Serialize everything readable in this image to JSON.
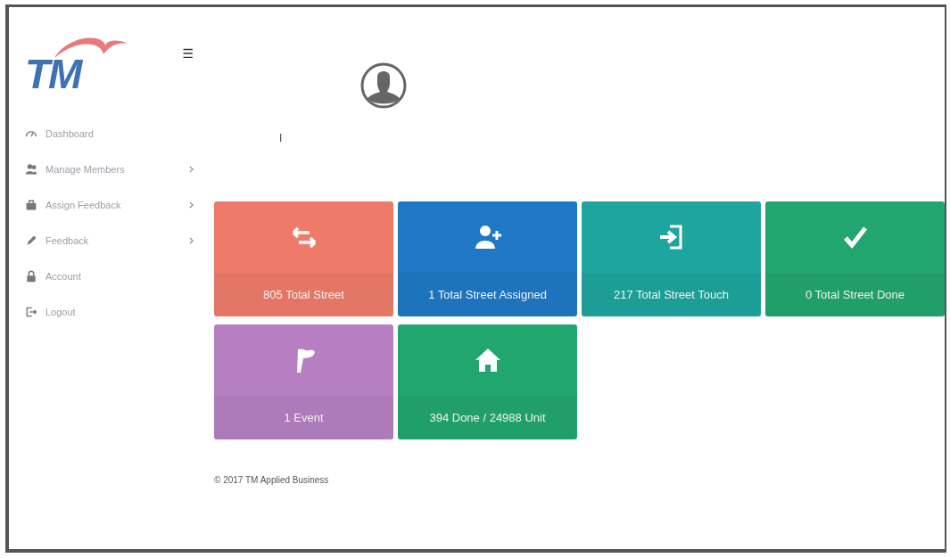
{
  "logo": {
    "text": "TM"
  },
  "menu_button": {
    "icon": "☰"
  },
  "sidebar": {
    "items": [
      {
        "label": "Dashboard",
        "kind": "gauge",
        "has_submenu": false
      },
      {
        "label": "Manage Members",
        "kind": "users",
        "has_submenu": true
      },
      {
        "label": "Assign Feedback",
        "kind": "briefcase",
        "has_submenu": true
      },
      {
        "label": "Feedback",
        "kind": "pen",
        "has_submenu": true
      },
      {
        "label": "Account",
        "kind": "lock",
        "has_submenu": false
      },
      {
        "label": "Logout",
        "kind": "logout",
        "has_submenu": false
      }
    ]
  },
  "profile": {
    "name": "I"
  },
  "tiles": [
    {
      "label": "805 Total Street",
      "kind": "exchange",
      "color": "#ee7b6a"
    },
    {
      "label": "1 Total Street Assigned",
      "kind": "userplus",
      "color": "#1f78c4"
    },
    {
      "label": "217 Total Street Touch",
      "kind": "signin",
      "color": "#1ea59d"
    },
    {
      "label": "0 Total Street Done",
      "kind": "check",
      "color": "#22a66f"
    },
    {
      "label": "1 Event",
      "kind": "flag",
      "color": "#b57fc2"
    },
    {
      "label": "394 Done / 24988 Unit",
      "kind": "home",
      "color": "#22a66f"
    }
  ],
  "footer": {
    "text": "© 2017 TM Applied Business"
  }
}
